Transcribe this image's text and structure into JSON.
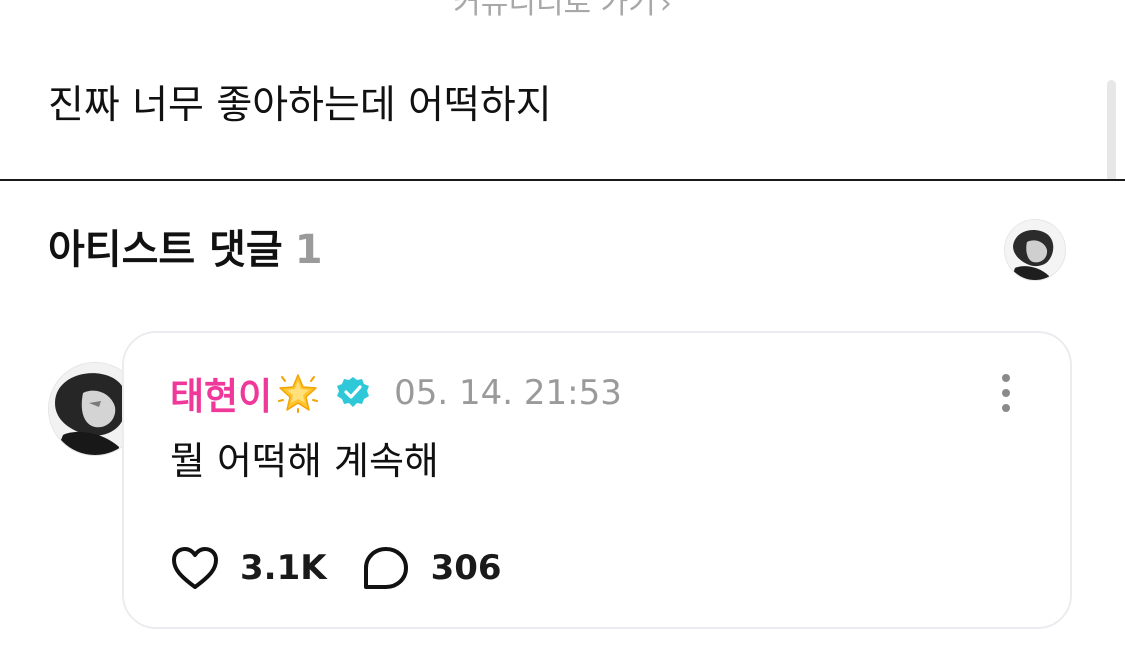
{
  "post": {
    "community_link_label": "커뮤니티로 가기",
    "community_link_chevron": "›",
    "body": "진짜 너무 좋아하는데 어떡하지"
  },
  "artist_comments": {
    "title": "아티스트 댓글",
    "count": "1",
    "header_avatar_icon": "profile-avatar"
  },
  "comment": {
    "author": "태현이",
    "author_color": "#f0389b",
    "badge_icon": "glowing-star-emoji",
    "verified_icon": "verified-check-badge",
    "verified_color": "#2ec8d8",
    "timestamp": "05. 14. 21:53",
    "text": "뭘 어떡해 계속해",
    "more_icon": "vertical-dots",
    "likes": "3.1K",
    "replies": "306"
  }
}
